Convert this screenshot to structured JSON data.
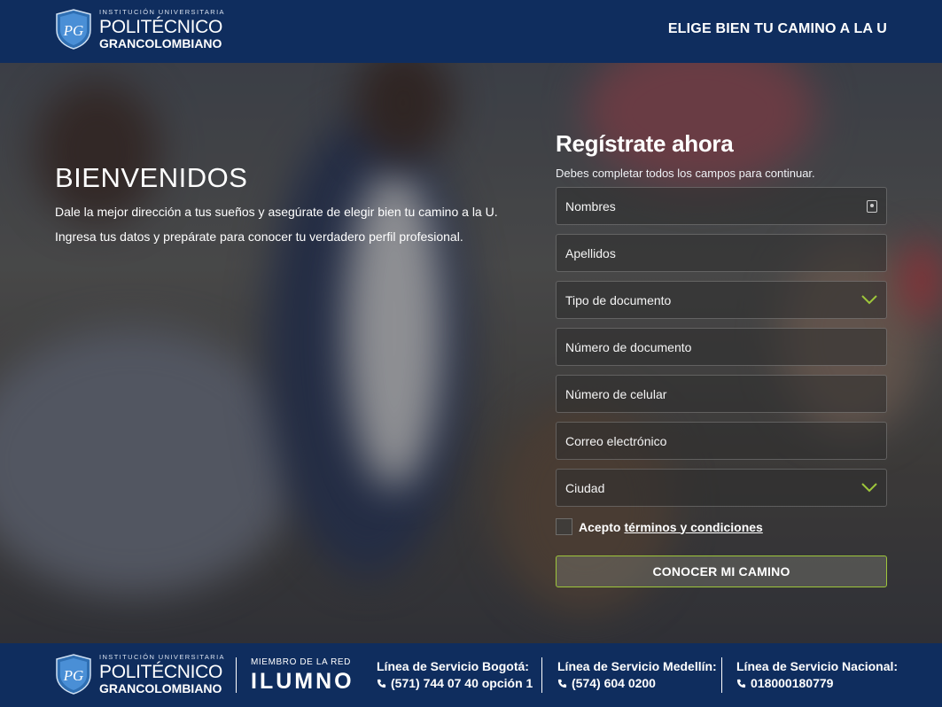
{
  "header": {
    "logo": {
      "small": "INSTITUCIÓN UNIVERSITARIA",
      "big": "POLITÉCNICO",
      "sub": "GRANCOLOMBIANO",
      "icon": "shield-logo-icon"
    },
    "tagline": "ELIGE BIEN TU CAMINO A LA U"
  },
  "welcome": {
    "title": "BIENVENIDOS",
    "line1": "Dale la mejor dirección a tus sueños y asegúrate de elegir bien tu camino a la U.",
    "line2": "Ingresa tus datos y prepárate para conocer tu verdadero perfil profesional."
  },
  "form": {
    "title": "Regístrate ahora",
    "hint": "Debes completar todos los campos para continuar.",
    "fields": {
      "nombres": "Nombres",
      "apellidos": "Apellidos",
      "tipo_documento": "Tipo de documento",
      "numero_documento": "Número de documento",
      "celular": "Número de celular",
      "correo": "Correo electrónico",
      "ciudad": "Ciudad"
    },
    "terms_prefix": "Acepto",
    "terms_link": "términos y condiciones",
    "terms_checked": false,
    "submit": "CONOCER MI CAMINO",
    "accent": "#9ec63b"
  },
  "footer": {
    "logo": {
      "small": "INSTITUCIÓN UNIVERSITARIA",
      "big": "POLITÉCNICO",
      "sub": "GRANCOLOMBIANO"
    },
    "member_label": "MIEMBRO DE LA RED",
    "member_brand": "ILUMNO",
    "lines": [
      {
        "title": "Línea de Servicio Bogotá:",
        "phone": "(571) 744 07 40 opción 1"
      },
      {
        "title": "Línea de Servicio Medellín:",
        "phone": "(574) 604 0200"
      },
      {
        "title": "Línea de Servicio Nacional:",
        "phone": "018000180779"
      }
    ]
  },
  "colors": {
    "navy": "#0f2d5e",
    "accent_green": "#9ec63b"
  }
}
